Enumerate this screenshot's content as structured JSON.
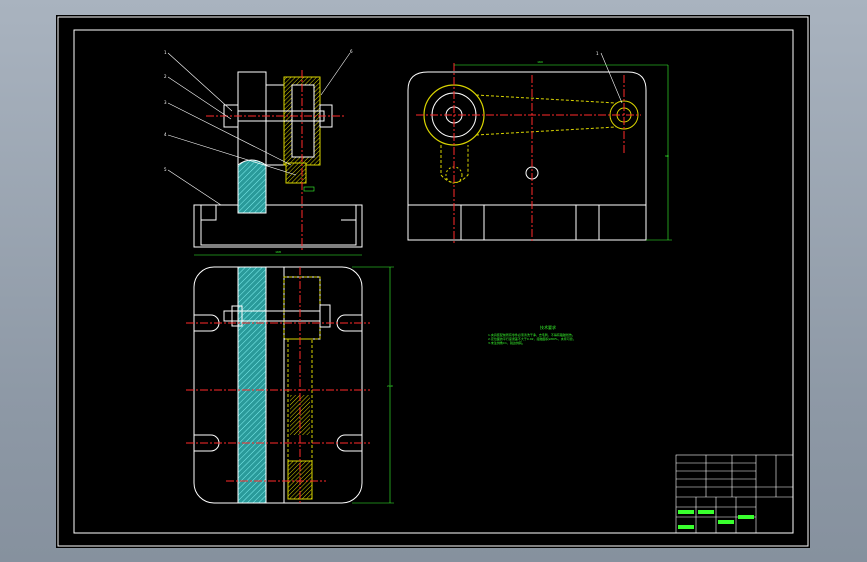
{
  "window": {
    "title": "",
    "background": "#000000",
    "frame_color": "#9aa4b0"
  },
  "colors": {
    "outline": "#ffffff",
    "centerline": "#ff2a2a",
    "dimension": "#39ff2e",
    "section_fill": "#3bbfbf",
    "part_fill": "#d9d400",
    "leader": "#ffffff"
  },
  "views": [
    {
      "id": "front-section-view",
      "label": ""
    },
    {
      "id": "side-view",
      "label": ""
    },
    {
      "id": "top-section-view",
      "label": ""
    }
  ],
  "balloons": [
    "1",
    "2",
    "3",
    "4",
    "5",
    "6"
  ],
  "dimensions": {
    "front_width": "168",
    "side_width": "160",
    "side_height": "90",
    "plan_height": "240"
  },
  "notes": {
    "title": "技术要求",
    "lines": [
      "1.夹具装配前所有零件必须清洗干净，去毛刺，不得有磕碰划伤。",
      "2.定位面的平行度误差不大于0.02，接触面积≥80%，夹紧可靠。",
      "3.未注倒角C1，锐边倒钝。"
    ]
  },
  "title_block": {
    "rows": [
      "",
      "",
      "",
      "",
      ""
    ]
  }
}
